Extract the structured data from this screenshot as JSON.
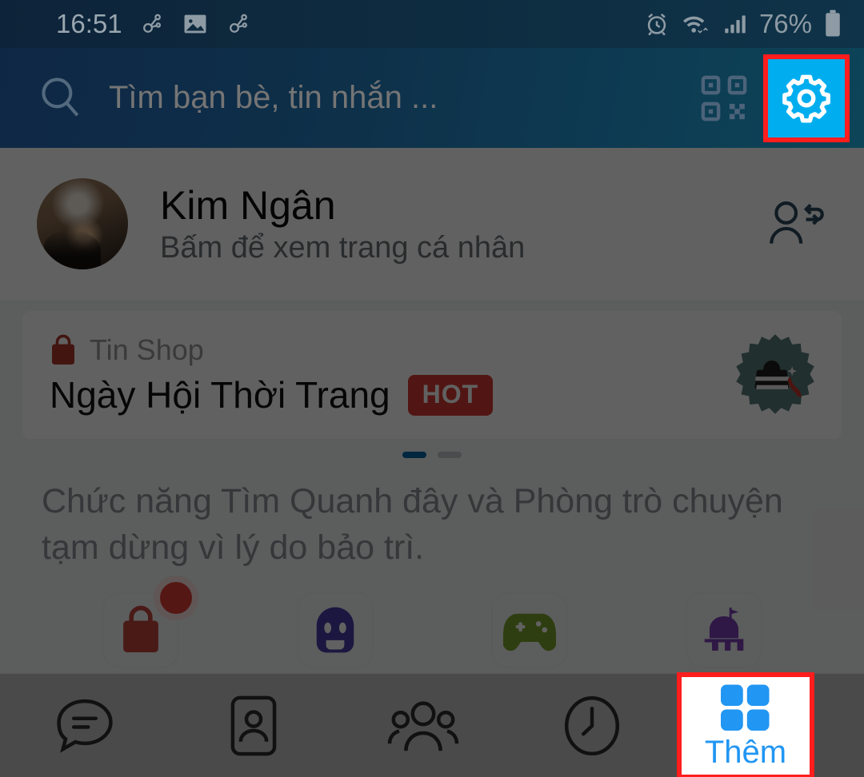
{
  "status_bar": {
    "time": "16:51",
    "battery_percent": "76%",
    "left_icons": [
      "bluetooth-share-icon",
      "image-icon",
      "bluetooth-share-icon"
    ],
    "right_icons": [
      "alarm-icon",
      "wifi-icon",
      "signal-icon",
      "battery-icon"
    ]
  },
  "header": {
    "search_placeholder": "Tìm bạn bè, tin nhắn ...",
    "search_value": "",
    "search_icon": "search-icon",
    "qr_icon": "qr-code-icon",
    "settings_icon": "gear-icon",
    "settings_highlight_color": "#ff1d1d",
    "settings_button_bg": "#00aeef"
  },
  "profile": {
    "name": "Kim Ngân",
    "subtitle": "Bấm để xem trang cá nhân",
    "switch_account_icon": "switch-account-icon",
    "avatar": "user-avatar"
  },
  "shop_card": {
    "label": "Tin Shop",
    "label_icon": "shopping-bag-icon",
    "title": "Ngày Hội Thời Trang",
    "badge": "HOT",
    "badge_color": "#d43a32",
    "thumbnail_icon": "fashion-badge-icon",
    "pagination": {
      "total": 2,
      "active_index": 0,
      "active_color": "#0068a5"
    }
  },
  "notice": {
    "text": "Chức năng Tìm Quanh đây và Phòng trò chuyện tạm dừng vì lý do bảo trì."
  },
  "apps": [
    {
      "name": "shop-app",
      "icon": "shopping-bag-icon",
      "color": "#e04b3c",
      "has_badge": true
    },
    {
      "name": "sticker-app",
      "icon": "robot-face-icon",
      "color": "#4b3ea8",
      "has_badge": false
    },
    {
      "name": "game-app",
      "icon": "game-controller-icon",
      "color": "#7aa32b",
      "has_badge": true
    },
    {
      "name": "services-app",
      "icon": "castle-icon",
      "color": "#7b3fb5",
      "has_badge": false
    }
  ],
  "bottom_nav": {
    "items": [
      {
        "name": "tab-messages",
        "icon": "chat-bubble-icon",
        "label": "",
        "active": false
      },
      {
        "name": "tab-contacts",
        "icon": "contact-card-icon",
        "label": "",
        "active": false
      },
      {
        "name": "tab-groups",
        "icon": "people-group-icon",
        "label": "",
        "active": false
      },
      {
        "name": "tab-timeline",
        "icon": "clock-icon",
        "label": "",
        "active": false
      }
    ],
    "more": {
      "label": "Thêm",
      "icon": "grid-squares-icon",
      "color": "#2196f3",
      "highlight_color": "#ff1d1d"
    }
  }
}
